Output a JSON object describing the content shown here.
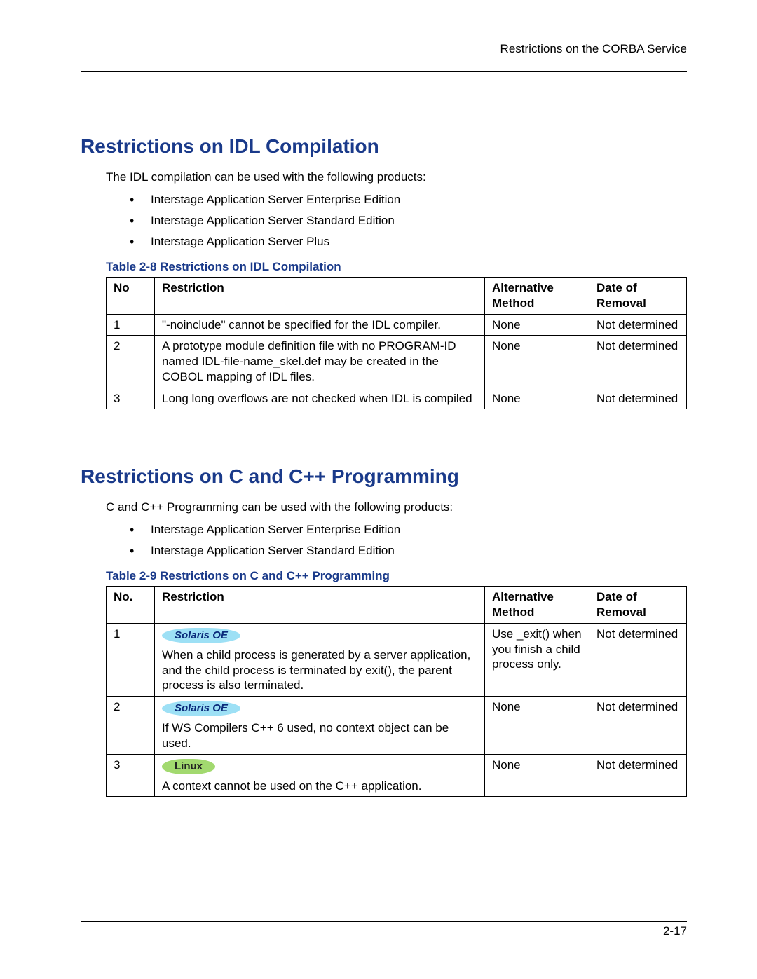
{
  "header": {
    "right_text": "Restrictions on the CORBA Service"
  },
  "footer": {
    "page_number": "2-17"
  },
  "section1": {
    "heading": "Restrictions on IDL Compilation",
    "intro": "The IDL compilation can be used with the following products:",
    "products": [
      "Interstage Application Server Enterprise Edition",
      "Interstage Application Server Standard Edition",
      "Interstage Application Server Plus"
    ],
    "caption": "Table 2-8  Restrictions on IDL Compilation"
  },
  "table1": {
    "headers": {
      "c1": "No",
      "c2": "Restriction",
      "c3": "Alternative Method",
      "c4": "Date of Removal"
    },
    "rows": [
      {
        "no": "1",
        "restriction": "\"-noinclude\" cannot be specified for the IDL compiler.",
        "alt": "None",
        "date": "Not determined"
      },
      {
        "no": "2",
        "restriction": "A prototype module definition file with no PROGRAM-ID named IDL-file-name_skel.def may be created in the COBOL mapping of IDL files.",
        "alt": "None",
        "date": "Not determined"
      },
      {
        "no": "3",
        "restriction": "Long long overflows are not checked when IDL is compiled",
        "alt": "None",
        "date": "Not determined"
      }
    ]
  },
  "section2": {
    "heading": "Restrictions on C and C++ Programming",
    "intro": "C and C++ Programming can be used with the following products:",
    "products": [
      "Interstage Application Server Enterprise Edition",
      "Interstage Application Server Standard Edition"
    ],
    "caption": "Table 2-9  Restrictions on C and C++ Programming"
  },
  "table2": {
    "headers": {
      "c1": "No.",
      "c2": "Restriction",
      "c3": "Alternative Method",
      "c4": "Date of Removal"
    },
    "rows": [
      {
        "no": "1",
        "badge": "Solaris OE",
        "badge_type": "solaris",
        "restriction": "When a child process is generated by a server application, and the child process is terminated by exit(), the parent process is also terminated.",
        "alt": "Use _exit() when you finish a child process only.",
        "date": "Not determined"
      },
      {
        "no": "2",
        "badge": "Solaris OE",
        "badge_type": "solaris",
        "restriction": "If WS Compilers C++ 6 used, no context object can be used.",
        "alt": "None",
        "date": "Not determined"
      },
      {
        "no": "3",
        "badge": "Linux",
        "badge_type": "linux",
        "restriction": "A context cannot be used on the C++ application.",
        "alt": "None",
        "date": "Not determined"
      }
    ]
  }
}
